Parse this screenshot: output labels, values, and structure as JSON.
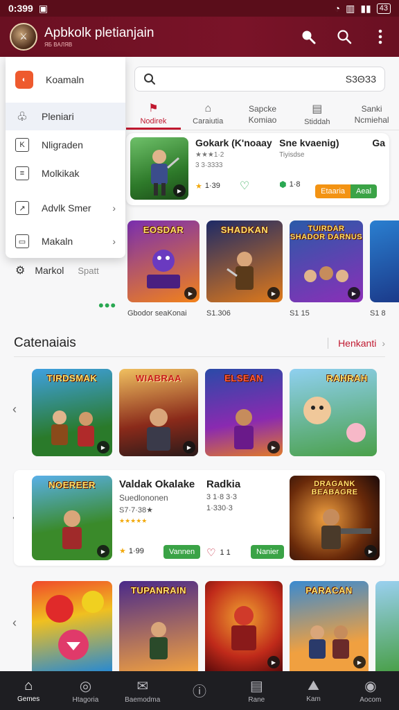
{
  "status": {
    "time": "0:399",
    "battery": "43"
  },
  "app": {
    "title": "Apbkolk pletianjain",
    "subtitle": "ЯБ ВАЛЯВ"
  },
  "search": {
    "placeholder": "",
    "code": "S3ΘЗ3"
  },
  "tabs": [
    {
      "label": "Nodirek"
    },
    {
      "label": "Caraiutia"
    },
    {
      "label": "Sapcke\nKomiao"
    },
    {
      "label": "Stiddah"
    },
    {
      "label": "Sanki\nNcmiehal"
    }
  ],
  "drawer": {
    "items": [
      {
        "label": "Koamaln"
      },
      {
        "label": "Pleniari"
      },
      {
        "label": "Nligraden"
      },
      {
        "label": "Molkikak"
      },
      {
        "label": "Advlk Smer"
      },
      {
        "label": "Makaln"
      }
    ]
  },
  "featured": {
    "name": "Gokark (K'noaay",
    "sub1": "★★★1·2",
    "sub2": "3 3·3333",
    "rating": "1·39",
    "name2": "Sne kvaenig)",
    "sub3": "Tiyisdse",
    "rating2": "1·8",
    "btn_orange": "Etaaria",
    "btn_green": "Aeal",
    "name3": "Ga"
  },
  "market": {
    "label": "Markol",
    "sub": "Spatt"
  },
  "row1_captions": [
    "Gbodor seaKonai",
    "S1.306",
    "S1 15",
    "S1 8"
  ],
  "row1_titles": [
    "EOSDAR",
    "SHADKAN",
    "TUIRDAR SHADOR DARNUS",
    ""
  ],
  "section": {
    "title": "Catenaiais",
    "see_all": "Henkanti"
  },
  "row2_titles": [
    "TIRDSMAK",
    "WIABRAA",
    "ELSEAN",
    "RAHRAH"
  ],
  "list": {
    "name1": "Valdak Okalake",
    "sub1": "Suedlononen",
    "sub2": "S7·7·38★",
    "stars": "★★★★★",
    "rating1": "1·99",
    "btn1": "Vannen",
    "name2": "Radkia",
    "sub3": "3 1·8 3·3",
    "sub4": "1·330·3",
    "rating2": "1 1",
    "btn2": "Nanier",
    "thumb1_title": "NOEREER",
    "thumb2_title": "DRAGANK BEABAGRE"
  },
  "row3_titles": [
    "",
    "TUPANRAIN",
    "",
    "PARACAN"
  ],
  "nav": [
    {
      "label": "Gemes"
    },
    {
      "label": "Htagoria"
    },
    {
      "label": "Baemodma"
    },
    {
      "label": ""
    },
    {
      "label": "Rane"
    },
    {
      "label": "Kam"
    },
    {
      "label": "Aocom"
    }
  ],
  "colors": {
    "brand": "#6a1022",
    "accent": "#c0182f",
    "green": "#3aa346",
    "orange": "#f39313"
  }
}
